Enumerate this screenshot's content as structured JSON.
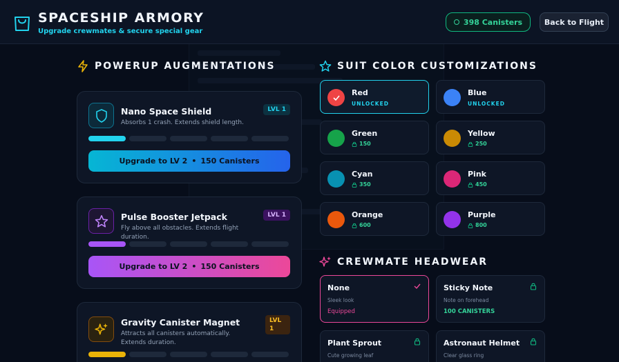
{
  "header": {
    "title": "SPACESHIP ARMORY",
    "subtitle": "Upgrade crewmates & secure special gear",
    "canisters": "398 Canisters",
    "back": "Back to Flight"
  },
  "sections": {
    "powerups": "POWERUP AUGMENTATIONS",
    "suits": "SUIT COLOR CUSTOMIZATIONS",
    "headwear": "CREWMATE HEADWEAR"
  },
  "powerups": [
    {
      "name": "Nano Space Shield",
      "desc": "Absorbs 1 crash. Extends shield length.",
      "level": "LVL 1",
      "level_value": 1,
      "level_max": 5,
      "upgrade": "Upgrade to LV 2",
      "cost": "150 Canisters",
      "accent": "#22d3ee",
      "icon": "shield-icon"
    },
    {
      "name": "Pulse Booster Jetpack",
      "desc": "Fly above all obstacles. Extends flight duration.",
      "level": "LVL 1",
      "level_value": 1,
      "level_max": 5,
      "upgrade": "Upgrade to LV 2",
      "cost": "150 Canisters",
      "accent": "#a855f7",
      "icon": "star-icon"
    },
    {
      "name": "Gravity Canister Magnet",
      "desc": "Attracts all canisters automatically. Extends duration.",
      "level": "LVL 1",
      "level_value": 1,
      "level_max": 5,
      "accent": "#eab308",
      "icon": "sparkles-icon"
    }
  ],
  "suits": [
    {
      "name": "Red",
      "status": "UNLOCKED",
      "color": "#ef4444",
      "selected": true
    },
    {
      "name": "Blue",
      "status": "UNLOCKED",
      "color": "#3b82f6"
    },
    {
      "name": "Green",
      "price": "150",
      "color": "#16a34a"
    },
    {
      "name": "Yellow",
      "price": "250",
      "color": "#ca8a04"
    },
    {
      "name": "Cyan",
      "price": "350",
      "color": "#0891b2"
    },
    {
      "name": "Pink",
      "price": "450",
      "color": "#db2777"
    },
    {
      "name": "Orange",
      "price": "600",
      "color": "#ea580c"
    },
    {
      "name": "Purple",
      "price": "800",
      "color": "#9333ea"
    }
  ],
  "headwear": [
    {
      "name": "None",
      "desc": "Sleek look",
      "status": "Equipped",
      "selected": true
    },
    {
      "name": "Sticky Note",
      "desc": "Note on forehead",
      "status": "100 CANISTERS"
    },
    {
      "name": "Plant Sprout",
      "desc": "Cute growing leaf"
    },
    {
      "name": "Astronaut Helmet",
      "desc": "Clear glass ring"
    }
  ]
}
